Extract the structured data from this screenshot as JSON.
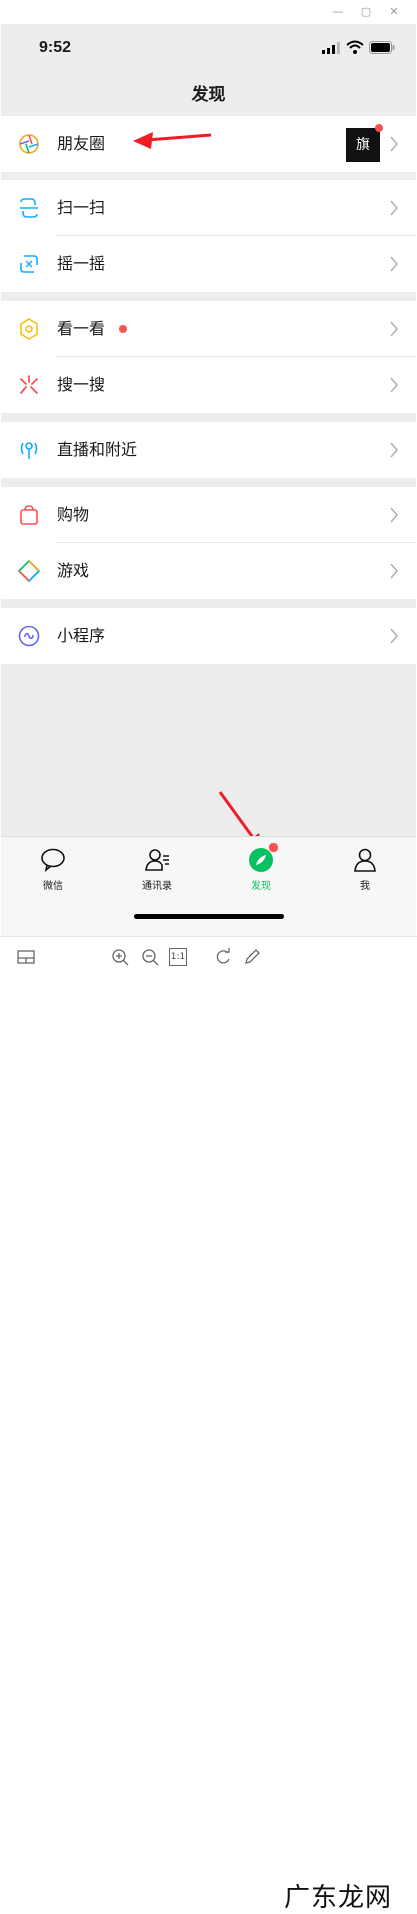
{
  "status": {
    "time": "9:52"
  },
  "header": {
    "title": "发现"
  },
  "groups": [
    {
      "items": [
        {
          "label": "朋友圈",
          "icon": "moments-icon",
          "thumb": "旗"
        }
      ]
    },
    {
      "items": [
        {
          "label": "扫一扫",
          "icon": "scan-icon"
        },
        {
          "label": "摇一摇",
          "icon": "shake-icon"
        }
      ]
    },
    {
      "items": [
        {
          "label": "看一看",
          "icon": "top-stories-icon"
        },
        {
          "label": "搜一搜",
          "icon": "search-icon"
        }
      ]
    },
    {
      "items": [
        {
          "label": "直播和附近",
          "icon": "live-nearby-icon"
        }
      ]
    },
    {
      "items": [
        {
          "label": "购物",
          "icon": "shopping-bag-icon"
        },
        {
          "label": "游戏",
          "icon": "game-icon"
        }
      ]
    },
    {
      "items": [
        {
          "label": "小程序",
          "icon": "mini-program-icon"
        }
      ]
    }
  ],
  "tabbar": {
    "tabs": [
      {
        "label": "微信",
        "icon": "chat-icon"
      },
      {
        "label": "通讯录",
        "icon": "contacts-icon"
      },
      {
        "label": "发现",
        "icon": "discover-compass-icon",
        "active": true
      },
      {
        "label": "我",
        "icon": "me-icon"
      }
    ]
  },
  "toolbar": {
    "zoom_ratio": "1:1"
  },
  "watermark": "广东龙网",
  "colors": {
    "accent": "#07c160",
    "badge": "#fa5151",
    "annotation_arrow": "#ee1c25",
    "background": "#ededed"
  }
}
